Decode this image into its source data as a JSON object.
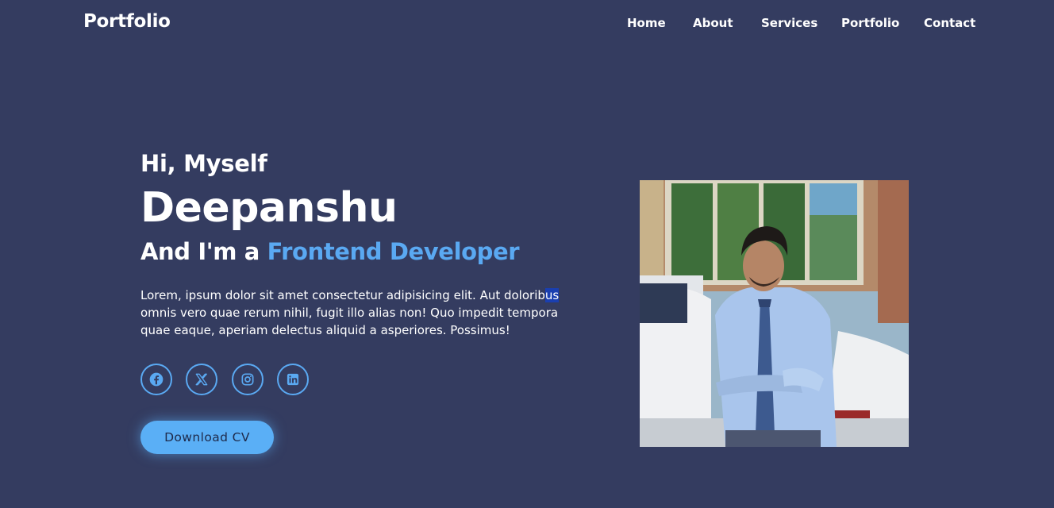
{
  "nav": {
    "logo": "Portfolio",
    "links": [
      {
        "label": "Home"
      },
      {
        "label": "About"
      },
      {
        "label": "Services"
      },
      {
        "label": "Portfolio"
      },
      {
        "label": "Contact"
      }
    ]
  },
  "hero": {
    "greeting": "Hi, Myself",
    "name": "Deepanshu",
    "role_prefix": "And I'm a ",
    "role_highlight": "Frontend Developer",
    "bio_part1": "Lorem, ipsum dolor sit amet consectetur adipisicing elit. Aut dolorib",
    "bio_selected": "us",
    "bio_part2": " omnis vero quae rerum nihil, fugit illo alias non! Quo impedit tempora quae eaque, aperiam delectus aliquid a asperiores. Possimus!",
    "cv_button": "Download CV"
  },
  "socials": [
    {
      "icon": "facebook-icon"
    },
    {
      "icon": "x-twitter-icon"
    },
    {
      "icon": "instagram-icon"
    },
    {
      "icon": "linkedin-icon"
    }
  ],
  "photo": {
    "subject": "profile-photo"
  },
  "colors": {
    "background": "#343c60",
    "accent": "#5aa9f2",
    "button": "#5aaff6",
    "text": "#ffffff"
  }
}
